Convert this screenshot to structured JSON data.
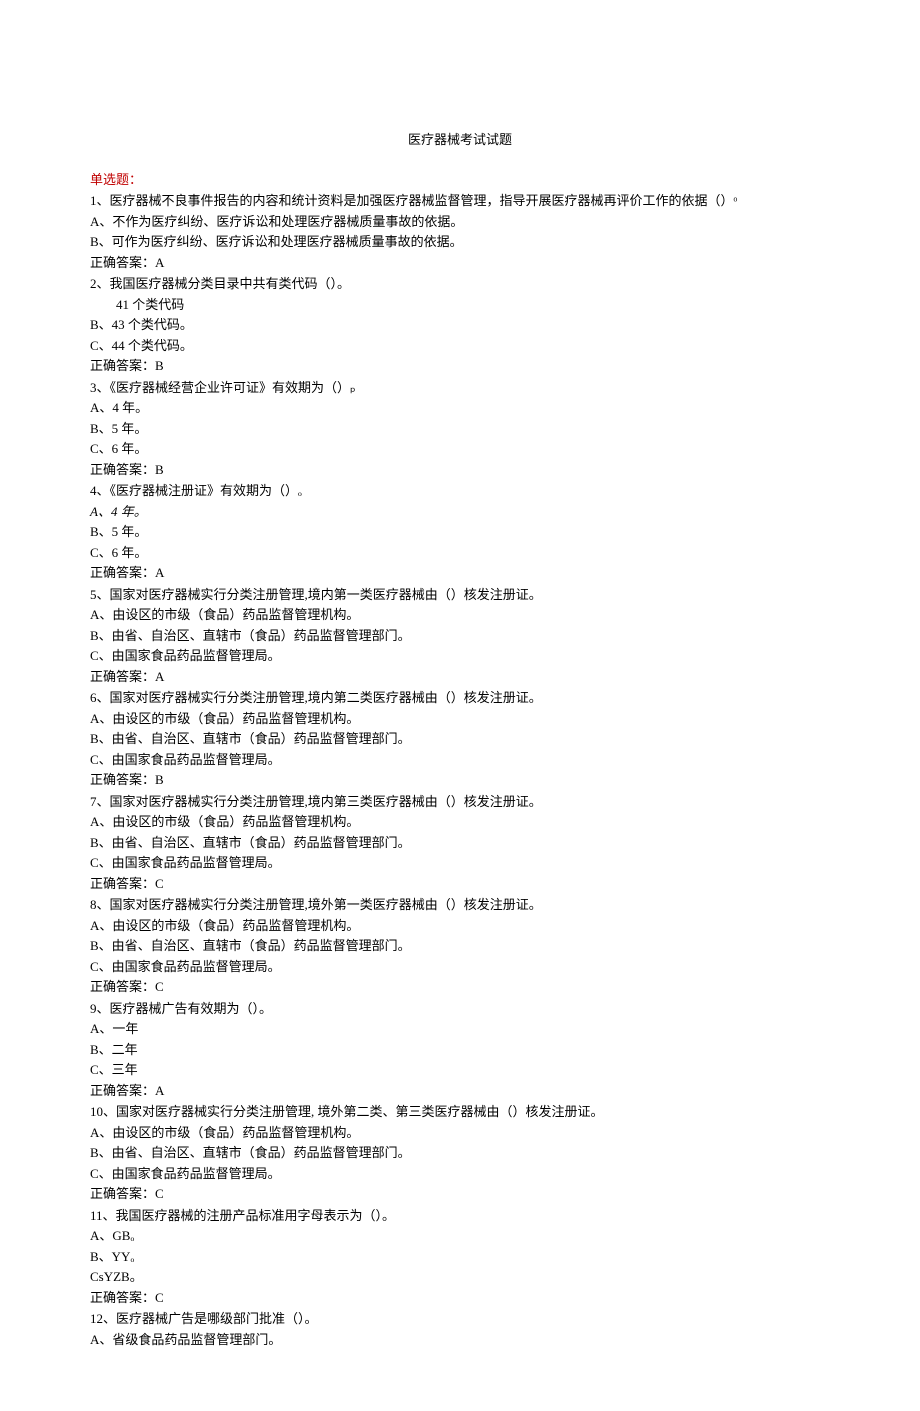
{
  "title": "医疗器械考试试题",
  "sectionHeader": "单选题：",
  "questions": [
    {
      "q": "1、医疗器械不良事件报告的内容和统计资料是加强医疗器械监督管理，指导开展医疗器械再评价工作的依据（）ᵒ",
      "opts": [
        "A、不作为医疗纠纷、医疗诉讼和处理医疗器械质量事故的依据。",
        "B、可作为医疗纠纷、医疗诉讼和处理医疗器械质量事故的依据。"
      ],
      "ans": "正确答案：A"
    },
    {
      "q": "2、我国医疗器械分类目录中共有类代码（）。",
      "opts": [
        {
          "text": "41 个类代码",
          "indent": true
        },
        "B、43 个类代码。",
        "C、44 个类代码。"
      ],
      "ans": "正确答案：B"
    },
    {
      "q": "3、《医疗器械经营企业许可证》有效期为（）ₚ",
      "opts": [
        "A、4 年。",
        "B、5 年。",
        "C、6 年。"
      ],
      "ans": "正确答案：B"
    },
    {
      "q": "4、《医疗器械注册证》有效期为（）ₒ",
      "opts": [
        {
          "text": "A、4 年。",
          "italic": true
        },
        "B、5 年。",
        "C、6 年。"
      ],
      "ans": "正确答案：A"
    },
    {
      "q": "5、国家对医疗器械实行分类注册管理,境内第一类医疗器械由（）核发注册证。",
      "opts": [
        "A、由设区的市级（食品）药品监督管理机构。",
        "B、由省、自治区、直辖市（食品）药品监督管理部门。",
        "C、由国家食品药品监督管理局。"
      ],
      "ans": "正确答案：A"
    },
    {
      "q": "6、国家对医疗器械实行分类注册管理,境内第二类医疗器械由（）核发注册证。",
      "opts": [
        "A、由设区的市级（食品）药品监督管理机构。",
        "B、由省、自治区、直辖市（食品）药品监督管理部门。",
        "C、由国家食品药品监督管理局。"
      ],
      "ans": "正确答案：B"
    },
    {
      "q": "7、国家对医疗器械实行分类注册管理,境内第三类医疗器械由（）核发注册证。",
      "opts": [
        "A、由设区的市级（食品）药品监督管理机构。",
        "B、由省、自治区、直辖市（食品）药品监督管理部门。",
        "C、由国家食品药品监督管理局。"
      ],
      "ans": "正确答案：C"
    },
    {
      "q": "8、国家对医疗器械实行分类注册管理,境外第一类医疗器械由（）核发注册证。",
      "opts": [
        "A、由设区的市级（食品）药品监督管理机构。",
        "B、由省、自治区、直辖市（食品）药品监督管理部门。",
        "C、由国家食品药品监督管理局。"
      ],
      "ans": "正确答案：C"
    },
    {
      "q": "9、医疗器械广告有效期为（）。",
      "opts": [
        "A、一年",
        "B、二年",
        "C、三年"
      ],
      "ans": "正确答案：A"
    },
    {
      "q": "10、国家对医疗器械实行分类注册管理, 境外第二类、第三类医疗器械由（）核发注册证。",
      "opts": [
        "A、由设区的市级（食品）药品监督管理机构。",
        "B、由省、自治区、直辖市（食品）药品监督管理部门。",
        "C、由国家食品药品监督管理局。"
      ],
      "ans": "正确答案：C"
    },
    {
      "q": "11、我国医疗器械的注册产品标准用字母表示为（）。",
      "opts": [
        "A、GBₒ",
        "B、YYₒ",
        "CsYZB。"
      ],
      "ans": "正确答案：C"
    },
    {
      "q": "12、医疗器械广告是哪级部门批准（）。",
      "opts": [
        "A、省级食品药品监督管理部门。"
      ],
      "ans": null
    }
  ]
}
